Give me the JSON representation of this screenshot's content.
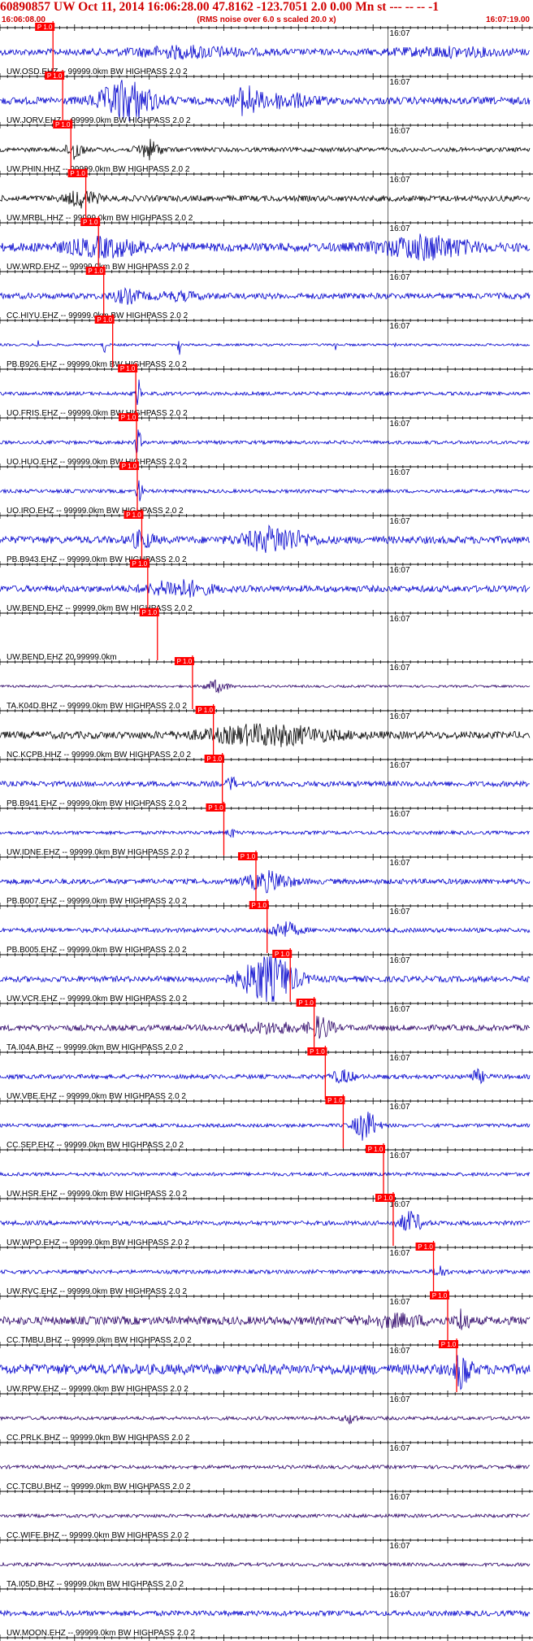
{
  "header": {
    "title": "60890857 UW Oct 11, 2014 16:06:28.00   47.8162 -123.7051  2.0 0.00 Mn st --- -- --  -1",
    "start_time": "16:06:08.00",
    "rms_note": "(RMS noise over 6.0 s scaled 20.0 x)",
    "end_time": "16:07:19.00"
  },
  "chart_data": {
    "type": "line",
    "x_range_sec": [
      0,
      71
    ],
    "start_time": "16:06:08.00",
    "end_time": "16:07:19.00",
    "minute_mark_label": "16:07",
    "minute_mark_sec": 52,
    "tick_interval_sec": 1,
    "pick_label": "P 1.0",
    "traces": [
      {
        "label": "UW.OSD.EHZ -- 99999.0km BW  HIGHPASS  2.0  2",
        "color": "#0000cc",
        "pick_sec": 7.1,
        "amp": 0.22,
        "bursts": [
          {
            "t": 25,
            "w": 15,
            "a": 0.3
          },
          {
            "t": 60,
            "w": 14,
            "a": 0.22
          }
        ]
      },
      {
        "label": "UW.JORV.EHZ -- 99999.0km BW  HIGHPASS  2.0  2",
        "color": "#0000cc",
        "pick_sec": 8.4,
        "amp": 0.25,
        "bursts": [
          {
            "t": 17,
            "w": 7,
            "a": 1.3
          },
          {
            "t": 33,
            "w": 3,
            "a": 0.9
          },
          {
            "t": 38,
            "w": 8,
            "a": 0.4
          }
        ]
      },
      {
        "label": "UW.PHIN.HHZ -- 99999.0km BW  HIGHPASS  2.0  2",
        "color": "#000000",
        "pick_sec": 9.5,
        "amp": 0.15,
        "bursts": [
          {
            "t": 10,
            "w": 2,
            "a": 0.7
          },
          {
            "t": 20,
            "w": 3,
            "a": 0.6
          }
        ]
      },
      {
        "label": "UW.MRBL.HHZ -- 99999.0km BW  HIGHPASS  2.0  2",
        "color": "#000000",
        "pick_sec": 11.5,
        "amp": 0.2,
        "bursts": [
          {
            "t": 11,
            "w": 4,
            "a": 0.5
          }
        ]
      },
      {
        "label": "UW.WRD.EHZ -- 99999.0km BW  HIGHPASS  2.0  2",
        "color": "#0000cc",
        "pick_sec": 13.2,
        "amp": 0.3,
        "bursts": [
          {
            "t": 14,
            "w": 10,
            "a": 0.5
          },
          {
            "t": 57,
            "w": 11,
            "a": 0.7
          }
        ]
      },
      {
        "label": "CC.HIYU.EHZ -- 99999.0km BW  HIGHPASS  2.0  2",
        "color": "#0000cc",
        "pick_sec": 13.9,
        "amp": 0.2,
        "bursts": [
          {
            "t": 17,
            "w": 4,
            "a": 0.4
          },
          {
            "t": 24,
            "w": 6,
            "a": 0.2
          }
        ]
      },
      {
        "label": "PB.B926.EHZ -- 99999.0km BW  HIGHPASS  2.0  2",
        "color": "#0000cc",
        "pick_sec": 15.1,
        "amp": 0.08,
        "bursts": [
          {
            "t": 5,
            "w": 0.3,
            "a": 0.5
          },
          {
            "t": 14,
            "w": 0.4,
            "a": 0.6
          },
          {
            "t": 24,
            "w": 0.3,
            "a": 0.8
          },
          {
            "t": 45,
            "w": 0.3,
            "a": 0.5
          },
          {
            "t": 53,
            "w": 0.3,
            "a": 0.3
          }
        ]
      },
      {
        "label": "UO.FRIS.EHZ -- 99999.0km BW  HIGHPASS  2.0  2",
        "color": "#0000cc",
        "pick_sec": 18.2,
        "amp": 0.12,
        "bursts": [
          {
            "t": 18.5,
            "w": 0.6,
            "a": 1.0
          }
        ]
      },
      {
        "label": "UO.HUO.EHZ -- 99999.0km BW  HIGHPASS  2.0  2",
        "color": "#0000cc",
        "pick_sec": 18.3,
        "amp": 0.12,
        "bursts": [
          {
            "t": 18.5,
            "w": 0.7,
            "a": 1.0
          }
        ]
      },
      {
        "label": "UO.IRO.EHZ -- 99999.0km BW  HIGHPASS  2.0  2",
        "color": "#0000cc",
        "pick_sec": 18.4,
        "amp": 0.12,
        "bursts": [
          {
            "t": 18.7,
            "w": 0.7,
            "a": 1.0
          }
        ]
      },
      {
        "label": "PB.B943.EHZ -- 99999.0km BW  HIGHPASS  2.0  2",
        "color": "#0000cc",
        "pick_sec": 19.0,
        "amp": 0.25,
        "bursts": [
          {
            "t": 37,
            "w": 8,
            "a": 0.8
          },
          {
            "t": 19,
            "w": 3,
            "a": 0.5
          }
        ]
      },
      {
        "label": "UW.BEND.EHZ -- 99999.0km BW  HIGHPASS  2.0  2",
        "color": "#0000cc",
        "pick_sec": 19.8,
        "amp": 0.22,
        "bursts": [
          {
            "t": 24,
            "w": 8,
            "a": 0.5
          }
        ]
      },
      {
        "label": "UW.BEND.EHZ 20.99999.0km",
        "color": "#0000cc",
        "pick_sec": 21.1,
        "amp": 0.0,
        "bursts": []
      },
      {
        "label": "TA.K04D.BHZ -- 99999.0km BW  HIGHPASS  2.0  2",
        "color": "#2a0066",
        "pick_sec": 25.8,
        "amp": 0.08,
        "bursts": [
          {
            "t": 29,
            "w": 3,
            "a": 0.4
          }
        ]
      },
      {
        "label": "NC.KCPB.HHZ -- 99999.0km BW  HIGHPASS  2.0  2",
        "color": "#000000",
        "pick_sec": 28.6,
        "amp": 0.25,
        "bursts": [
          {
            "t": 36,
            "w": 16,
            "a": 0.6
          }
        ]
      },
      {
        "label": "PB.B941.EHZ -- 99999.0km BW  HIGHPASS  2.0  2",
        "color": "#0000cc",
        "pick_sec": 29.8,
        "amp": 0.18,
        "bursts": [
          {
            "t": 31,
            "w": 1,
            "a": 0.5
          }
        ]
      },
      {
        "label": "UW.IDNE.EHZ -- 99999.0km BW  HIGHPASS  2.0  2",
        "color": "#0000cc",
        "pick_sec": 30.0,
        "amp": 0.12,
        "bursts": [
          {
            "t": 31,
            "w": 1,
            "a": 0.3
          }
        ]
      },
      {
        "label": "PB.B007.EHZ -- 99999.0km BW  HIGHPASS  2.0  2",
        "color": "#0000cc",
        "pick_sec": 34.3,
        "amp": 0.18,
        "bursts": [
          {
            "t": 36,
            "w": 6,
            "a": 0.6
          }
        ]
      },
      {
        "label": "PB.B005.EHZ -- 99999.0km BW  HIGHPASS  2.0  2",
        "color": "#0000cc",
        "pick_sec": 35.8,
        "amp": 0.15,
        "bursts": [
          {
            "t": 38,
            "w": 4,
            "a": 0.5
          }
        ]
      },
      {
        "label": "UW.VCR.EHZ -- 99999.0km BW  HIGHPASS  2.0  2",
        "color": "#0000cc",
        "pick_sec": 38.9,
        "amp": 0.2,
        "bursts": [
          {
            "t": 36,
            "w": 7,
            "a": 1.6
          }
        ]
      },
      {
        "label": "TA.I04A.BHZ -- 99999.0km BW  HIGHPASS  2.0  2",
        "color": "#2a0066",
        "pick_sec": 42.1,
        "amp": 0.2,
        "bursts": [
          {
            "t": 43,
            "w": 3,
            "a": 0.7
          },
          {
            "t": 36,
            "w": 8,
            "a": 0.3
          }
        ]
      },
      {
        "label": "UW.VBE.EHZ -- 99999.0km BW  HIGHPASS  2.0  2",
        "color": "#0000cc",
        "pick_sec": 43.6,
        "amp": 0.15,
        "bursts": [
          {
            "t": 46,
            "w": 3,
            "a": 0.4
          },
          {
            "t": 64,
            "w": 2,
            "a": 0.4
          }
        ]
      },
      {
        "label": "CC.SEP.EHZ -- 99999.0km BW  HIGHPASS  2.0  2",
        "color": "#0000cc",
        "pick_sec": 46.0,
        "amp": 0.12,
        "bursts": [
          {
            "t": 49,
            "w": 3,
            "a": 1.0
          }
        ]
      },
      {
        "label": "UW.HSR.EHZ -- 99999.0km BW  HIGHPASS  2.0  2",
        "color": "#0000cc",
        "pick_sec": 51.4,
        "amp": 0.12,
        "bursts": []
      },
      {
        "label": "UW.WPO.EHZ -- 99999.0km BW  HIGHPASS  2.0  2",
        "color": "#0000cc",
        "pick_sec": 52.7,
        "amp": 0.15,
        "bursts": [
          {
            "t": 55,
            "w": 3,
            "a": 0.7
          }
        ]
      },
      {
        "label": "UW.RVC.EHZ -- 99999.0km BW  HIGHPASS  2.0  2",
        "color": "#0000cc",
        "pick_sec": 58.1,
        "amp": 0.13,
        "bursts": [
          {
            "t": 59,
            "w": 1.5,
            "a": 0.4
          }
        ]
      },
      {
        "label": "CC.TMBU.BHZ -- 99999.0km BW  HIGHPASS  2.0  2",
        "color": "#2a0066",
        "pick_sec": 60.0,
        "amp": 0.28,
        "bursts": [
          {
            "t": 53,
            "w": 8,
            "a": 0.3
          },
          {
            "t": 62,
            "w": 1.5,
            "a": 0.8
          }
        ]
      },
      {
        "label": "UW.RPW.EHZ -- 99999.0km BW  HIGHPASS  2.0  2",
        "color": "#0000cc",
        "pick_sec": 61.2,
        "amp": 0.35,
        "bursts": [
          {
            "t": 62,
            "w": 2,
            "a": 1.2
          }
        ]
      },
      {
        "label": "CC.PRLK.BHZ -- 99999.0km BW  HIGHPASS  2.0  2",
        "color": "#2a0066",
        "pick_sec": null,
        "amp": 0.12,
        "bursts": [
          {
            "t": 47,
            "w": 2,
            "a": 0.3
          }
        ]
      },
      {
        "label": "CC.TCBU.BHZ -- 99999.0km BW  HIGHPASS  2.0  2",
        "color": "#2a0066",
        "pick_sec": null,
        "amp": 0.12,
        "bursts": []
      },
      {
        "label": "CC.WIFE.BHZ -- 99999.0km BW  HIGHPASS  2.0  2",
        "color": "#2a0066",
        "pick_sec": null,
        "amp": 0.12,
        "bursts": []
      },
      {
        "label": "TA.I05D.BHZ -- 99999.0km BW  HIGHPASS  2.0  2",
        "color": "#2a0066",
        "pick_sec": null,
        "amp": 0.12,
        "bursts": []
      },
      {
        "label": "UW.MOON.EHZ -- 99999.0km BW  HIGHPASS  2.0  2",
        "color": "#0000cc",
        "pick_sec": null,
        "amp": 0.18,
        "bursts": []
      }
    ],
    "colors": {
      "pick": "#ff0000",
      "header": "#d00000",
      "axis": "#000000"
    }
  }
}
